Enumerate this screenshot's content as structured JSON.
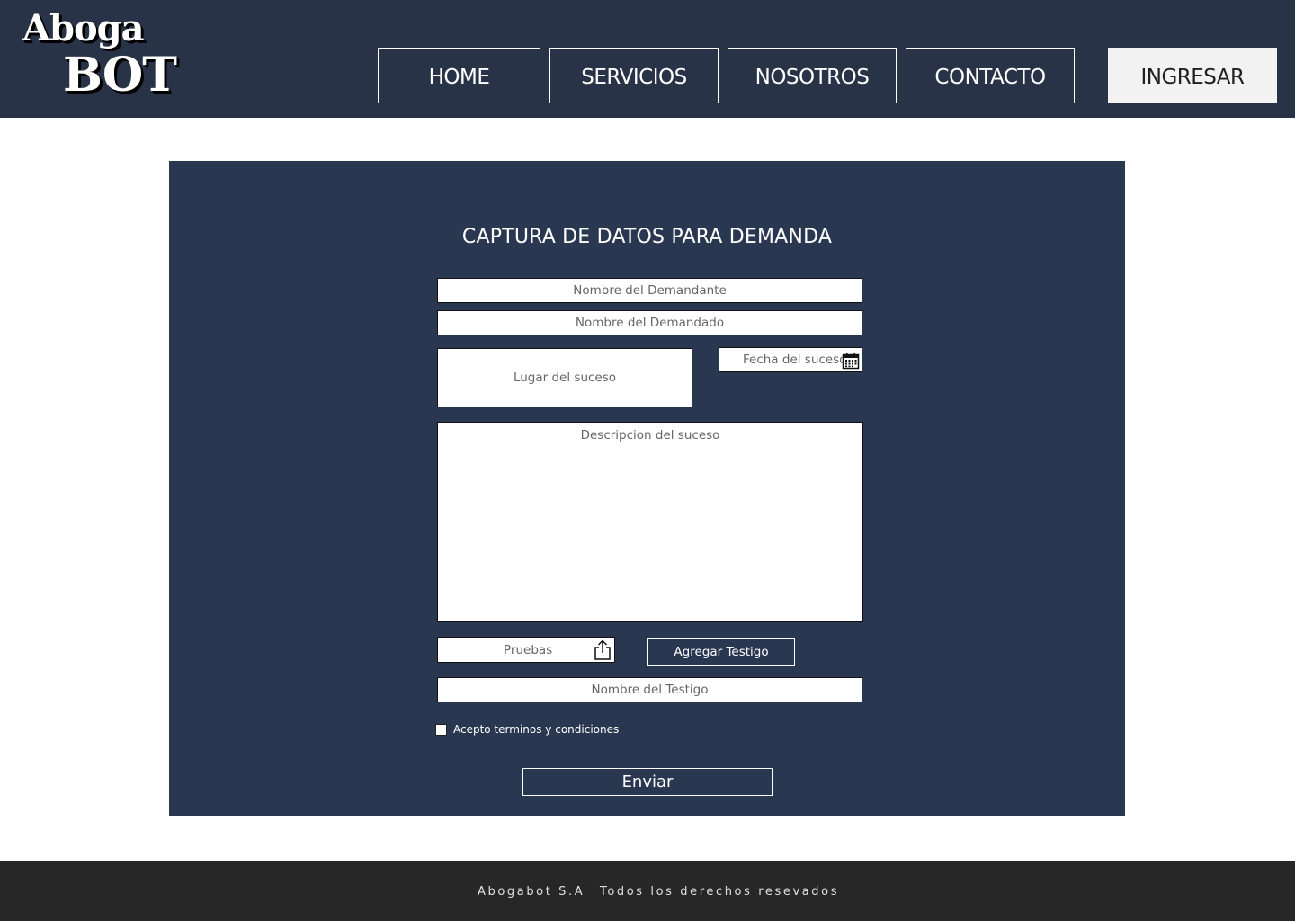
{
  "brand": {
    "logo_line1": "Aboga",
    "logo_line2": "BOT"
  },
  "nav": {
    "home": "HOME",
    "servicios": "SERVICIOS",
    "nosotros": "NOSOTROS",
    "contacto": "CONTACTO",
    "ingresar": "INGRESAR"
  },
  "form": {
    "title": "CAPTURA DE DATOS PARA DEMANDA",
    "demandante_placeholder": "Nombre del Demandante",
    "demandado_placeholder": "Nombre del Demandado",
    "lugar_placeholder": "Lugar del suceso",
    "fecha_placeholder": "Fecha del suceso",
    "descripcion_placeholder": "Descripcion del suceso",
    "pruebas_placeholder": "Pruebas",
    "agregar_testigo_label": "Agregar Testigo",
    "testigo_placeholder": "Nombre del Testigo",
    "terms_label": "Acepto terminos y condiciones",
    "terms_checked": false,
    "submit_label": "Enviar"
  },
  "footer": {
    "company": "Abogabot S.A",
    "rights": "Todos los derechos resevados"
  },
  "colors": {
    "header_bg": "#293347",
    "panel_bg": "#293850",
    "footer_bg": "#272727",
    "ingresar_bg": "#f2f2f2"
  },
  "icons": {
    "fecha": "calendar-icon",
    "pruebas": "upload-share-icon"
  }
}
